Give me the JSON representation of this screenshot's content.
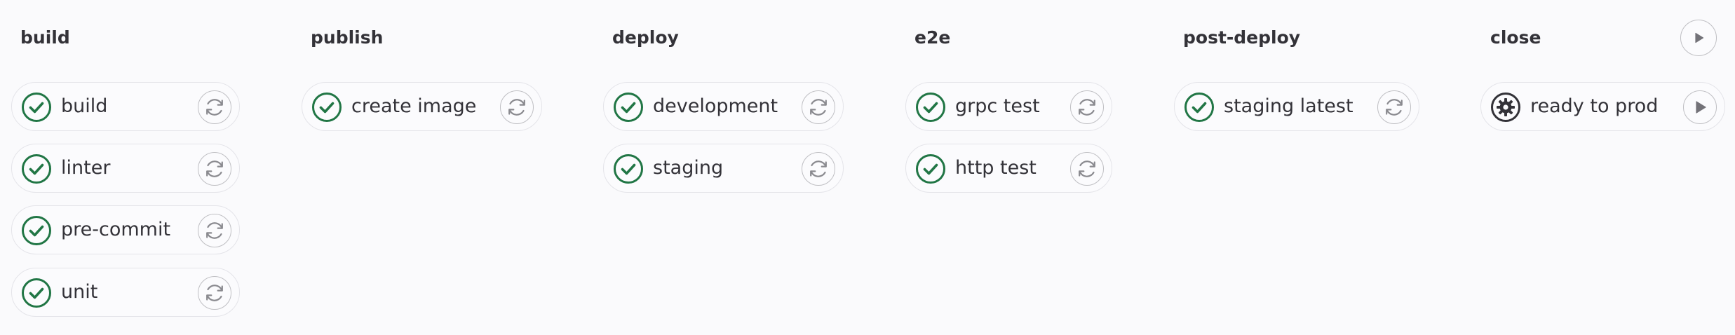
{
  "colors": {
    "success": "#217645",
    "manual": "#333238",
    "border": "#e4e4e9",
    "action_border": "#bfbfc3",
    "background": "#fafafc"
  },
  "stages": [
    {
      "name": "build",
      "jobs": [
        {
          "label": "build",
          "status_icon": "check-circle-icon",
          "action_icon": "retry-icon"
        },
        {
          "label": "linter",
          "status_icon": "check-circle-icon",
          "action_icon": "retry-icon"
        },
        {
          "label": "pre-commit",
          "status_icon": "check-circle-icon",
          "action_icon": "retry-icon"
        },
        {
          "label": "unit",
          "status_icon": "check-circle-icon",
          "action_icon": "retry-icon"
        }
      ]
    },
    {
      "name": "publish",
      "jobs": [
        {
          "label": "create image",
          "status_icon": "check-circle-icon",
          "action_icon": "retry-icon"
        }
      ]
    },
    {
      "name": "deploy",
      "jobs": [
        {
          "label": "development",
          "status_icon": "check-circle-icon",
          "action_icon": "retry-icon"
        },
        {
          "label": "staging",
          "status_icon": "check-circle-icon",
          "action_icon": "retry-icon"
        }
      ]
    },
    {
      "name": "e2e",
      "jobs": [
        {
          "label": "grpc test",
          "status_icon": "check-circle-icon",
          "action_icon": "retry-icon"
        },
        {
          "label": "http test",
          "status_icon": "check-circle-icon",
          "action_icon": "retry-icon"
        }
      ]
    },
    {
      "name": "post-deploy",
      "jobs": [
        {
          "label": "staging latest",
          "status_icon": "check-circle-icon",
          "action_icon": "retry-icon"
        }
      ]
    },
    {
      "name": "close",
      "stage_action_icon": "play-icon",
      "jobs": [
        {
          "label": "ready to prod",
          "status_icon": "gear-icon",
          "action_icon": "play-icon"
        }
      ]
    }
  ]
}
